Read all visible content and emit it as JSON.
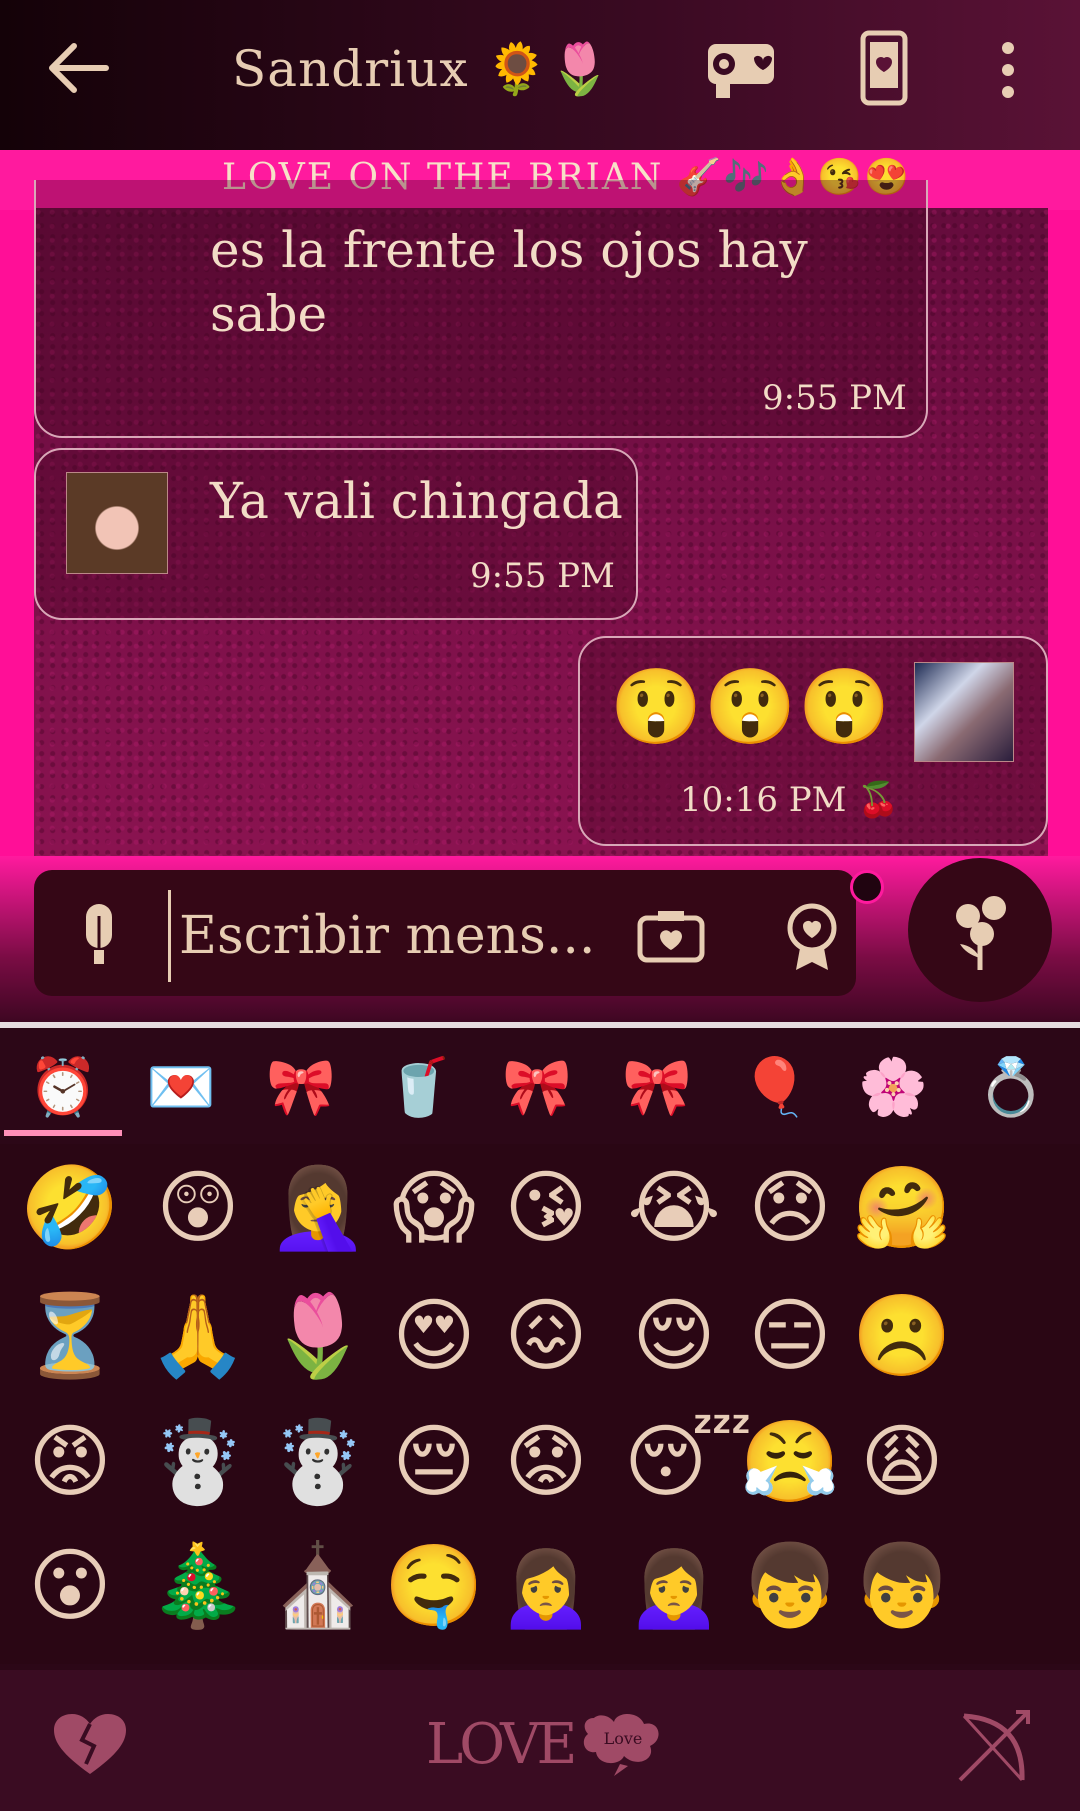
{
  "header": {
    "back_icon": "arrow-left-icon",
    "title": "Sandriux 🌻🌷",
    "video_icon": "video-camera-heart-icon",
    "phone_icon": "phone-heart-icon",
    "more_icon": "more-vertical-icon"
  },
  "banner": {
    "text": "LOVE ON THE BRIAN 🎸🎶👌😘😍"
  },
  "messages": [
    {
      "text": "es la frente los ojos hay sabe",
      "time": "9:55 PM"
    },
    {
      "text": "Ya vali chingada",
      "time": "9:55 PM"
    },
    {
      "text": "😲😲😲",
      "time": "10:16 PM 🍒"
    }
  ],
  "composer": {
    "placeholder": "Escribir mens...",
    "mic_icon": "microphone-icon",
    "camera_icon": "camera-heart-icon",
    "medal_icon": "heart-medal-icon",
    "send_icon": "flower-send-icon"
  },
  "emoji_tabs": [
    "⏰",
    "💌",
    "🎀",
    "🥤",
    "🎀",
    "🎀",
    "🎈",
    "🌸",
    "💍"
  ],
  "emoji_grid": [
    [
      "🤣",
      "😲",
      "🤦‍♀️",
      "😱",
      "😘",
      "😭",
      "😞",
      "🤗"
    ],
    [
      "⏳",
      "🙏",
      "🌷",
      "😍",
      "😖",
      "😌",
      "😑",
      "☹️"
    ],
    [
      "😡",
      "☃️",
      "☃️",
      "😔",
      "😟",
      "😴",
      "😤",
      "😩"
    ],
    [
      "😮",
      "🎄",
      "⛪",
      "🤤",
      "🙍‍♀️",
      "🙍‍♀️",
      "👦",
      "👦"
    ]
  ],
  "bottom_bar": {
    "heart_icon": "broken-heart-icon",
    "love_text": "LOVE",
    "love_bubble_text": "Love",
    "arrow_icon": "cupid-bow-icon"
  },
  "colors": {
    "accent": "#ff1a9e",
    "text": "#e7cdb3",
    "background": "#2c0717"
  }
}
